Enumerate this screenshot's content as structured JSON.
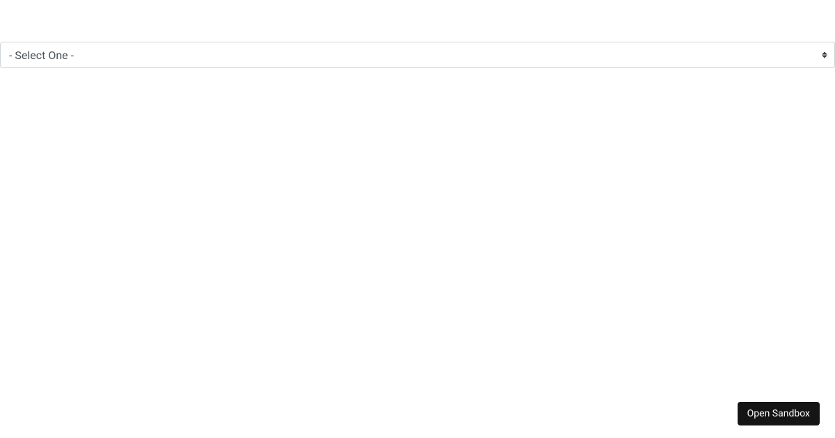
{
  "select": {
    "selected_label": "- Select One -"
  },
  "sandbox_button": {
    "label": "Open Sandbox"
  }
}
